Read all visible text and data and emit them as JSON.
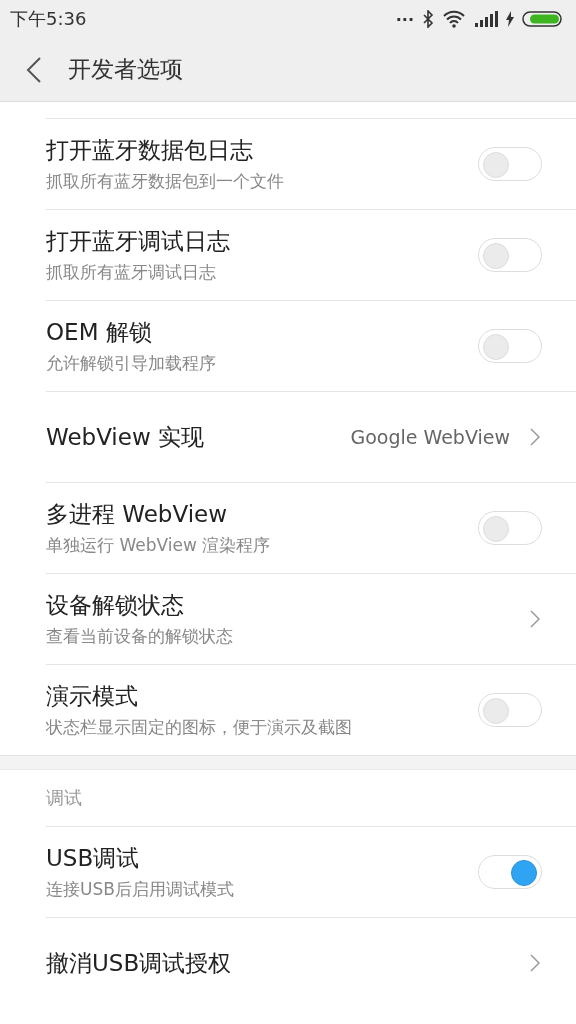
{
  "status_bar": {
    "time": "下午5:36",
    "more": "..."
  },
  "header": {
    "title": "开发者选项"
  },
  "groups": [
    {
      "items": [
        {
          "kind": "switch",
          "title": "打开蓝牙数据包日志",
          "subtitle": "抓取所有蓝牙数据包到一个文件",
          "on": false
        },
        {
          "kind": "switch",
          "title": "打开蓝牙调试日志",
          "subtitle": "抓取所有蓝牙调试日志",
          "on": false
        },
        {
          "kind": "switch",
          "title": "OEM 解锁",
          "subtitle": "允许解锁引导加载程序",
          "on": false
        },
        {
          "kind": "link",
          "title": "WebView 实现",
          "value": "Google WebView"
        },
        {
          "kind": "switch",
          "title": "多进程 WebView",
          "subtitle": "单独运行 WebView 渲染程序",
          "on": false
        },
        {
          "kind": "link",
          "title": "设备解锁状态",
          "subtitle": "查看当前设备的解锁状态"
        },
        {
          "kind": "switch",
          "title": "演示模式",
          "subtitle": "状态栏显示固定的图标，便于演示及截图",
          "on": false
        }
      ]
    },
    {
      "heading": "调试",
      "items": [
        {
          "kind": "switch",
          "title": "USB调试",
          "subtitle": "连接USB后启用调试模式",
          "on": true
        },
        {
          "kind": "link",
          "title": "撤消USB调试授权"
        }
      ]
    }
  ]
}
